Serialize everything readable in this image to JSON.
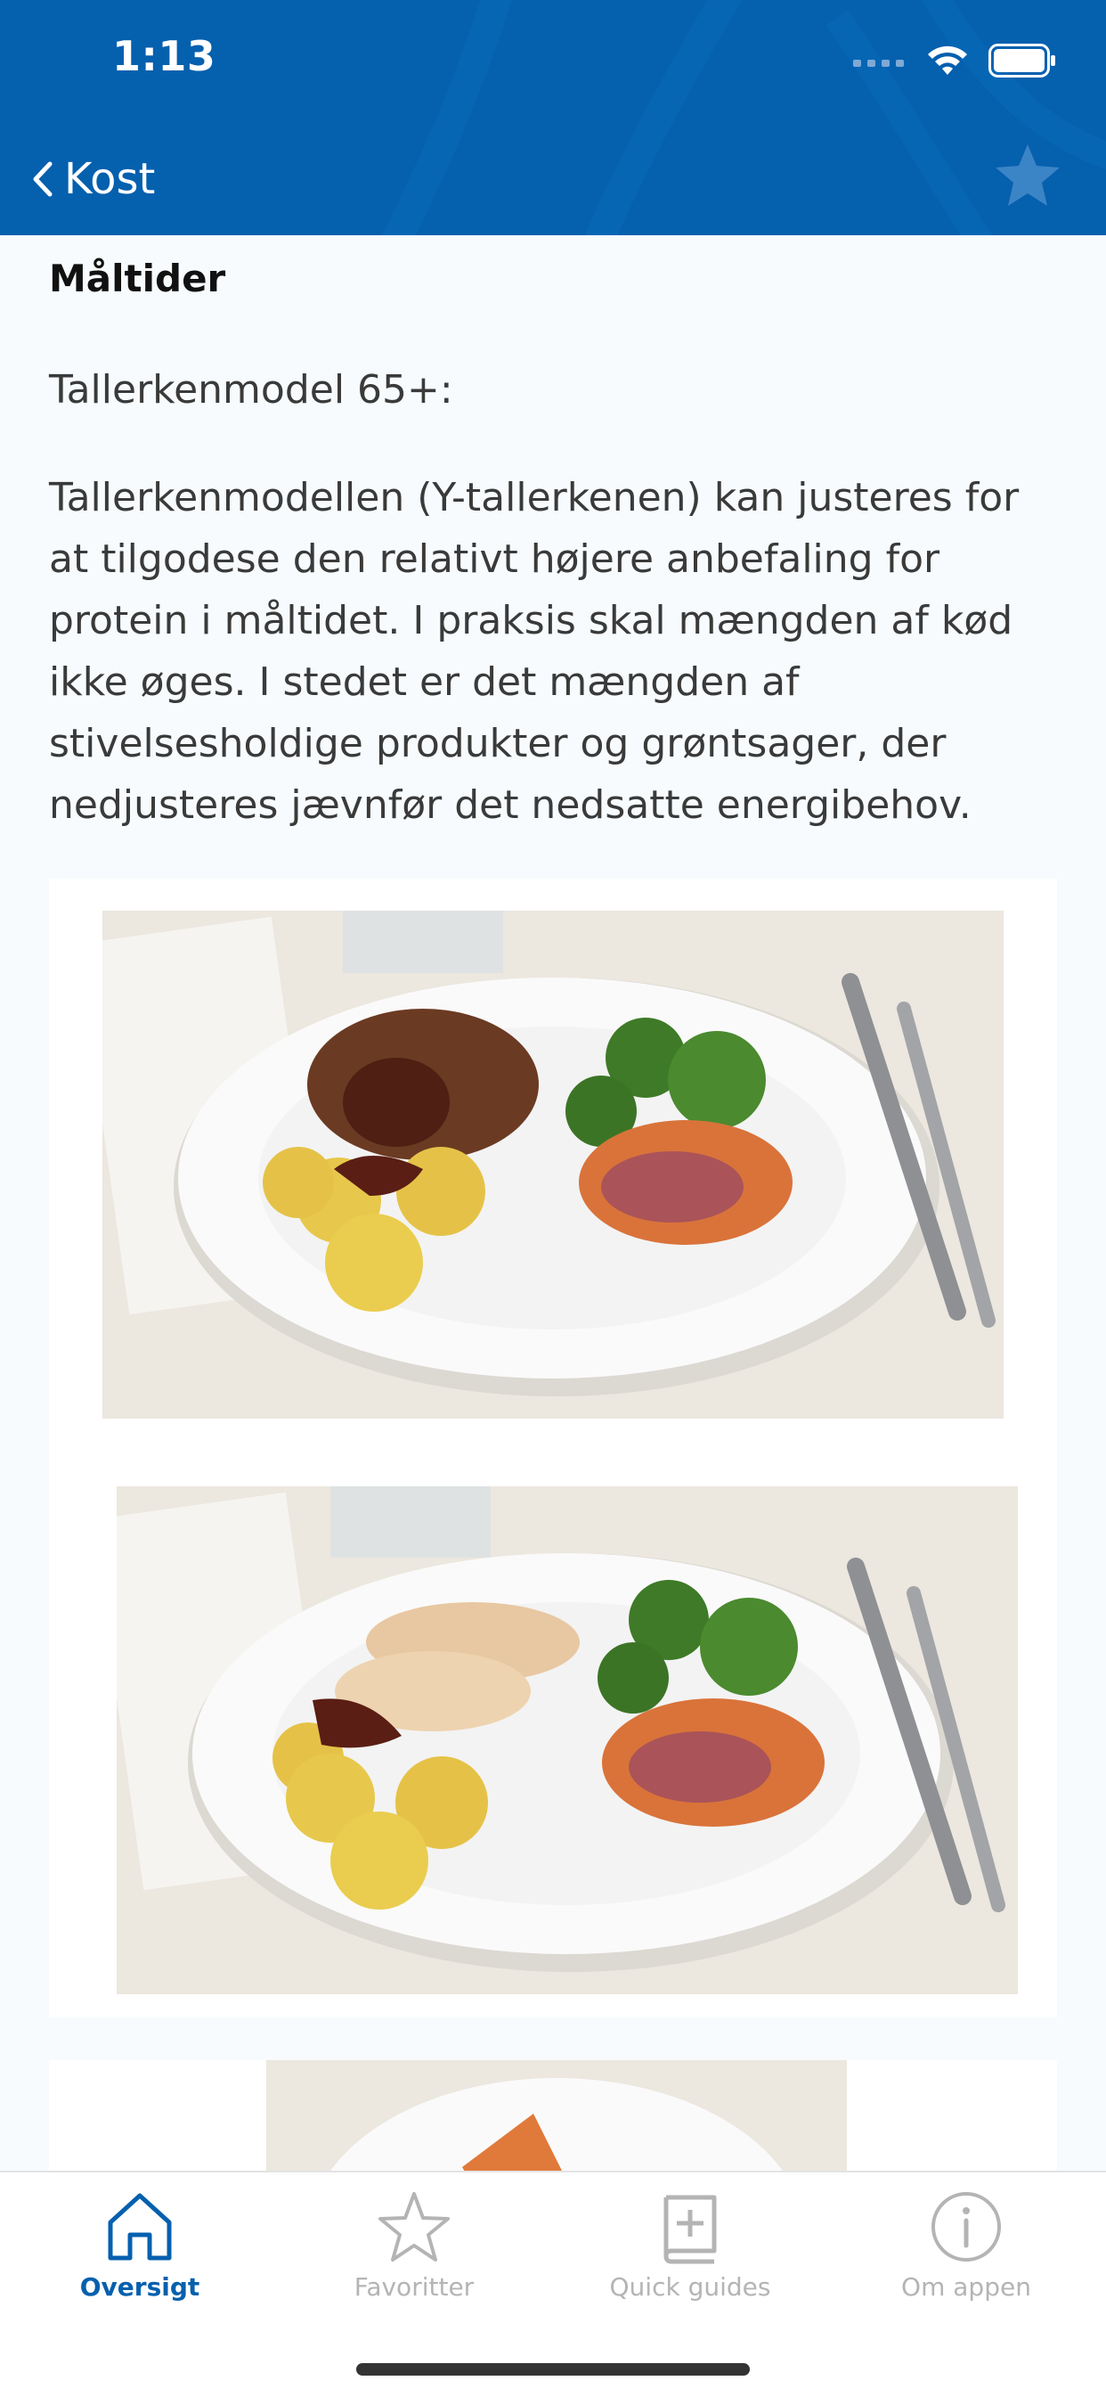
{
  "status_bar": {
    "time": "1:13"
  },
  "nav": {
    "back_label": "Kost"
  },
  "content": {
    "section_title": "Måltider",
    "subtitle": "Tallerkenmodel 65+:",
    "paragraph": "Tallerkenmodellen (Y-tallerkenen) kan justeres for at tilgodese den relativt højere anbefaling for protein i måltidet. I praksis skal mængden af kød ikke øges. I stedet er det mængden af stivelsesholdige produkter og grøntsager, der nedjusteres jævnfør det nedsatte energibehov."
  },
  "tabs": [
    {
      "label": "Oversigt",
      "icon": "house-icon",
      "active": true
    },
    {
      "label": "Favoritter",
      "icon": "star-icon",
      "active": false
    },
    {
      "label": "Quick guides",
      "icon": "book-plus-icon",
      "active": false
    },
    {
      "label": "Om appen",
      "icon": "info-icon",
      "active": false
    }
  ],
  "colors": {
    "primary": "#0560AE",
    "background": "#F7FBFD",
    "tab_inactive": "#B4B4B4"
  }
}
